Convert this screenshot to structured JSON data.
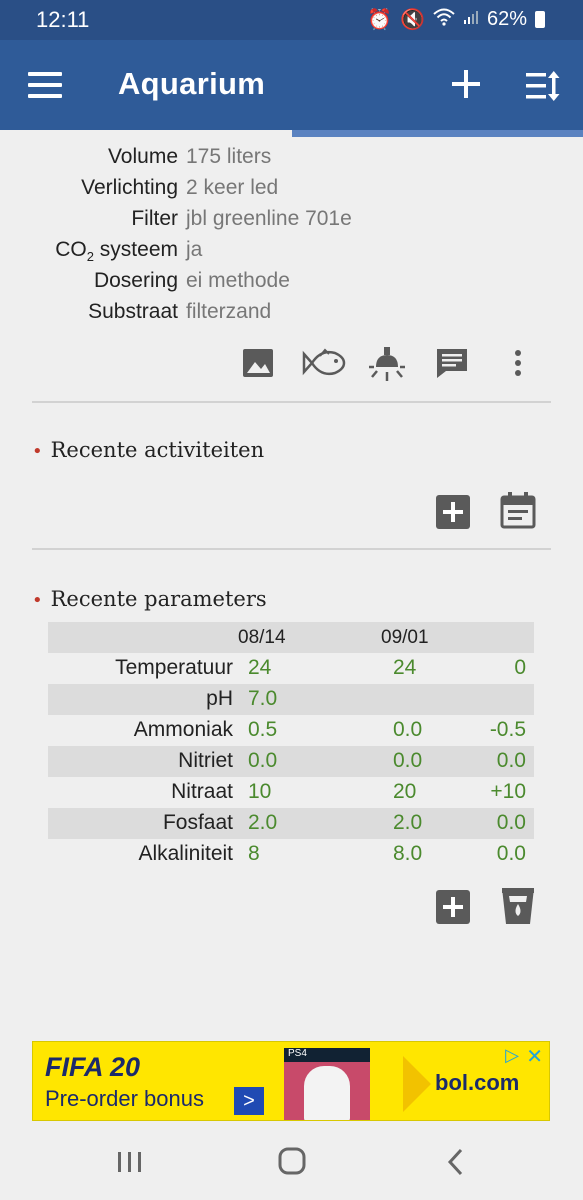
{
  "status_bar": {
    "time": "12:11",
    "battery": "62%",
    "icons": [
      "alarm-icon",
      "mute-icon",
      "wifi-icon",
      "signal-icon",
      "battery-icon"
    ]
  },
  "app_bar": {
    "title": "Aquarium",
    "color": "#2f5b98",
    "icons": [
      "menu-icon",
      "add-icon",
      "sort-icon"
    ]
  },
  "details": [
    {
      "label": "Volume",
      "value": "175 liters"
    },
    {
      "label": "Verlichting",
      "value": "2 keer led"
    },
    {
      "label": "Filter",
      "value": "jbl greenline 701e"
    },
    {
      "label_main": "CO",
      "label_sub": "2",
      "label_rest": " systeem",
      "value": "ja"
    },
    {
      "label": "Dosering",
      "value": "ei methode"
    },
    {
      "label": "Substraat",
      "value": "filterzand"
    }
  ],
  "detail_actions": [
    "image-icon",
    "fish-icon",
    "light-icon",
    "comment-icon",
    "more-vert-icon"
  ],
  "recent_activities": {
    "title": "Recente activiteiten",
    "actions": [
      "add-icon",
      "calendar-icon"
    ]
  },
  "recent_parameters": {
    "title": "Recente parameters",
    "dates": [
      "08/14",
      "09/01"
    ],
    "rows": [
      {
        "name": "Temperatuur",
        "v1": "24",
        "v2": "24",
        "diff": "0"
      },
      {
        "name": "pH",
        "v1": "7.0",
        "v2": "",
        "diff": ""
      },
      {
        "name": "Ammoniak",
        "v1": "0.5",
        "v2": "0.0",
        "diff": "-0.5"
      },
      {
        "name": "Nitriet",
        "v1": "0.0",
        "v2": "0.0",
        "diff": "0.0"
      },
      {
        "name": "Nitraat",
        "v1": "10",
        "v2": "20",
        "diff": "+10"
      },
      {
        "name": "Fosfaat",
        "v1": "2.0",
        "v2": "2.0",
        "diff": "0.0"
      },
      {
        "name": "Alkaliniteit",
        "v1": "8",
        "v2": "8.0",
        "diff": "0.0"
      }
    ],
    "actions": [
      "add-icon",
      "test-cup-icon"
    ],
    "value_color": "#4b8a2e"
  },
  "ad": {
    "title": "FIFA 20",
    "subtitle": "Pre-order bonus",
    "arrow": ">",
    "badge": "PS4",
    "brand": "bol.com",
    "close": "✕",
    "choices": "▷"
  },
  "nav_bar": {
    "icons": [
      "recents-icon",
      "home-icon",
      "back-icon"
    ]
  }
}
